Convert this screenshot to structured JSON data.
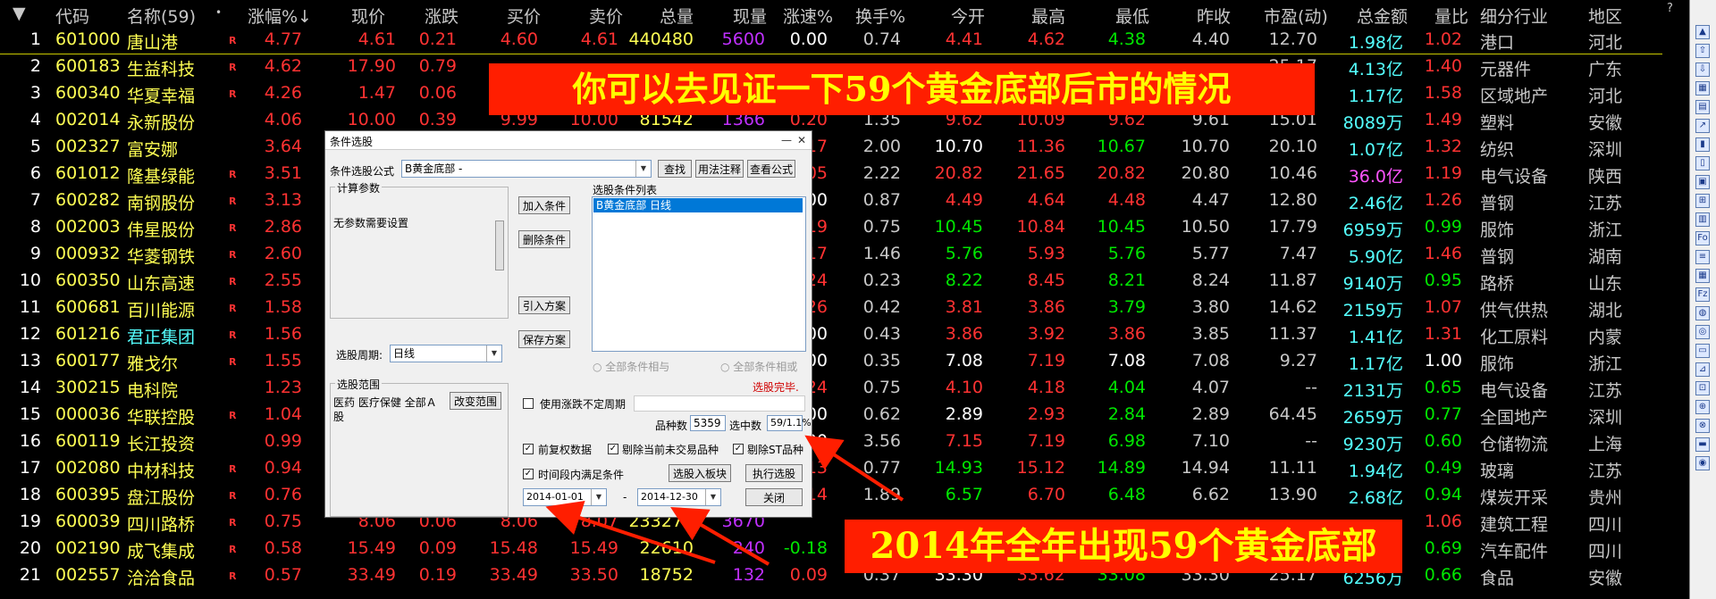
{
  "header": {
    "menu_arrow": "▼",
    "code": "代码",
    "name": "名称(59)",
    "dot": "•",
    "pct": "涨幅%↓",
    "price": "现价",
    "change": "涨跌",
    "bid": "买价",
    "ask": "卖价",
    "volume": "总量",
    "cur_vol": "现量",
    "speed": "涨速%",
    "turnover": "换手%",
    "open": "今开",
    "high": "最高",
    "low": "最低",
    "prev": "昨收",
    "pe": "市盈(动)",
    "amount": "总金额",
    "vol_ratio": "量比",
    "industry": "细分行业",
    "region": "地区",
    "help": "?"
  },
  "rows": [
    {
      "no": "1",
      "code": "601000",
      "name": "唐山港",
      "r": "R",
      "pct": "4.77",
      "price": "4.61",
      "change": "0.21",
      "bid": "4.60",
      "ask": "4.61",
      "volume": "440480",
      "cur_vol": "5600",
      "speed": "0.00",
      "turnover": "0.74",
      "open": "4.41",
      "high": "4.62",
      "low": "4.38",
      "prev": "4.40",
      "pe": "12.70",
      "amount": "1.98亿",
      "vol_ratio": "1.02",
      "industry": "港口",
      "region": "河北"
    },
    {
      "no": "2",
      "code": "600183",
      "name": "生益科技",
      "r": "R",
      "pct": "4.62",
      "price": "17.90",
      "change": "0.79",
      "bid": "",
      "ask": "",
      "volume": "",
      "cur_vol": "",
      "speed": "",
      "turnover": "",
      "open": "",
      "high": "",
      "low": "",
      "prev": "",
      "pe": "25.17",
      "amount": "4.13亿",
      "vol_ratio": "1.40",
      "industry": "元器件",
      "region": "广东"
    },
    {
      "no": "3",
      "code": "600340",
      "name": "华夏幸福",
      "r": "R",
      "pct": "4.26",
      "price": "1.47",
      "change": "0.06",
      "bid": "",
      "ask": "",
      "volume": "",
      "cur_vol": "",
      "speed": "",
      "turnover": "",
      "open": "",
      "high": "",
      "low": "",
      "prev": "",
      "pe": "",
      "amount": "1.17亿",
      "vol_ratio": "1.58",
      "industry": "区域地产",
      "region": "河北"
    },
    {
      "no": "4",
      "code": "002014",
      "name": "永新股份",
      "r": "",
      "pct": "4.06",
      "price": "10.00",
      "change": "0.39",
      "bid": "9.99",
      "ask": "10.00",
      "volume": "81542",
      "cur_vol": "1366",
      "speed": "0.20",
      "turnover": "1.35",
      "open": "9.62",
      "high": "10.09",
      "low": "9.62",
      "prev": "9.61",
      "pe": "15.01",
      "amount": "8089万",
      "vol_ratio": "1.49",
      "industry": "塑料",
      "region": "安徽"
    },
    {
      "no": "5",
      "code": "002327",
      "name": "富安娜",
      "r": "",
      "pct": "3.64",
      "price": "",
      "change": "",
      "bid": "",
      "ask": "",
      "volume": "",
      "cur_vol": "",
      "speed": "17",
      "turnover": "2.00",
      "open": "10.70",
      "high": "11.36",
      "low": "10.67",
      "prev": "10.70",
      "pe": "20.10",
      "amount": "1.07亿",
      "vol_ratio": "1.32",
      "industry": "纺织",
      "region": "深圳"
    },
    {
      "no": "6",
      "code": "601012",
      "name": "隆基绿能",
      "r": "R",
      "pct": "3.51",
      "price": "",
      "change": "",
      "bid": "",
      "ask": "",
      "volume": "",
      "cur_vol": "",
      "speed": "05",
      "turnover": "2.22",
      "open": "20.82",
      "high": "21.65",
      "low": "20.82",
      "prev": "20.80",
      "pe": "10.46",
      "amount": "36.0亿",
      "vol_ratio": "1.19",
      "industry": "电气设备",
      "region": "陕西"
    },
    {
      "no": "7",
      "code": "600282",
      "name": "南钢股份",
      "r": "R",
      "pct": "3.13",
      "price": "",
      "change": "",
      "bid": "",
      "ask": "",
      "volume": "",
      "cur_vol": "",
      "speed": "00",
      "turnover": "0.87",
      "open": "4.49",
      "high": "4.64",
      "low": "4.48",
      "prev": "4.47",
      "pe": "12.80",
      "amount": "2.46亿",
      "vol_ratio": "1.26",
      "industry": "普钢",
      "region": "江苏"
    },
    {
      "no": "8",
      "code": "002003",
      "name": "伟星股份",
      "r": "R",
      "pct": "2.86",
      "price": "",
      "change": "",
      "bid": "",
      "ask": "",
      "volume": "",
      "cur_vol": "",
      "speed": "19",
      "turnover": "0.75",
      "open": "10.45",
      "high": "10.84",
      "low": "10.45",
      "prev": "10.50",
      "pe": "17.79",
      "amount": "6959万",
      "vol_ratio": "0.99",
      "industry": "服饰",
      "region": "浙江"
    },
    {
      "no": "9",
      "code": "000932",
      "name": "华菱钢铁",
      "r": "R",
      "pct": "2.60",
      "price": "",
      "change": "",
      "bid": "",
      "ask": "",
      "volume": "",
      "cur_vol": "",
      "speed": "17",
      "turnover": "1.46",
      "open": "5.76",
      "high": "5.93",
      "low": "5.76",
      "prev": "5.77",
      "pe": "7.47",
      "amount": "5.90亿",
      "vol_ratio": "1.46",
      "industry": "普钢",
      "region": "湖南"
    },
    {
      "no": "10",
      "code": "600350",
      "name": "山东高速",
      "r": "R",
      "pct": "2.55",
      "price": "",
      "change": "",
      "bid": "",
      "ask": "",
      "volume": "",
      "cur_vol": "",
      "speed": "24",
      "turnover": "0.23",
      "open": "8.22",
      "high": "8.45",
      "low": "8.21",
      "prev": "8.24",
      "pe": "11.87",
      "amount": "9140万",
      "vol_ratio": "0.95",
      "industry": "路桥",
      "region": "山东"
    },
    {
      "no": "11",
      "code": "600681",
      "name": "百川能源",
      "r": "R",
      "pct": "1.58",
      "price": "",
      "change": "",
      "bid": "",
      "ask": "",
      "volume": "",
      "cur_vol": "",
      "speed": "26",
      "turnover": "0.42",
      "open": "3.81",
      "high": "3.86",
      "low": "3.79",
      "prev": "3.80",
      "pe": "14.62",
      "amount": "2159万",
      "vol_ratio": "1.07",
      "industry": "供气供热",
      "region": "湖北"
    },
    {
      "no": "12",
      "code": "601216",
      "name": "君正集团",
      "r": "R",
      "pct": "1.56",
      "price": "",
      "change": "",
      "bid": "",
      "ask": "",
      "volume": "",
      "cur_vol": "",
      "speed": "00",
      "turnover": "0.43",
      "open": "3.86",
      "high": "3.92",
      "low": "3.86",
      "prev": "3.85",
      "pe": "11.37",
      "amount": "1.41亿",
      "vol_ratio": "1.31",
      "industry": "化工原料",
      "region": "内蒙"
    },
    {
      "no": "13",
      "code": "600177",
      "name": "雅戈尔",
      "r": "R",
      "pct": "1.55",
      "price": "",
      "change": "",
      "bid": "",
      "ask": "",
      "volume": "",
      "cur_vol": "",
      "speed": "00",
      "turnover": "0.35",
      "open": "7.08",
      "high": "7.19",
      "low": "7.08",
      "prev": "7.08",
      "pe": "9.27",
      "amount": "1.17亿",
      "vol_ratio": "1.00",
      "industry": "服饰",
      "region": "浙江"
    },
    {
      "no": "14",
      "code": "300215",
      "name": "电科院",
      "r": "",
      "pct": "1.23",
      "price": "",
      "change": "",
      "bid": "",
      "ask": "",
      "volume": "",
      "cur_vol": "",
      "speed": "24",
      "turnover": "0.75",
      "open": "4.10",
      "high": "4.18",
      "low": "4.04",
      "prev": "4.07",
      "pe": "--",
      "amount": "2131万",
      "vol_ratio": "0.65",
      "industry": "电气设备",
      "region": "江苏"
    },
    {
      "no": "15",
      "code": "000036",
      "name": "华联控股",
      "r": "R",
      "pct": "1.04",
      "price": "",
      "change": "",
      "bid": "",
      "ask": "",
      "volume": "",
      "cur_vol": "",
      "speed": "00",
      "turnover": "0.62",
      "open": "2.89",
      "high": "2.93",
      "low": "2.84",
      "prev": "2.89",
      "pe": "64.45",
      "amount": "2659万",
      "vol_ratio": "0.77",
      "industry": "全国地产",
      "region": "深圳"
    },
    {
      "no": "16",
      "code": "600119",
      "name": "长江投资",
      "r": "",
      "pct": "0.99",
      "price": "",
      "change": "",
      "bid": "",
      "ask": "",
      "volume": "",
      "cur_vol": "",
      "speed": "00",
      "turnover": "3.56",
      "open": "7.15",
      "high": "7.19",
      "low": "6.98",
      "prev": "7.10",
      "pe": "--",
      "amount": "9230万",
      "vol_ratio": "0.60",
      "industry": "仓储物流",
      "region": "上海"
    },
    {
      "no": "17",
      "code": "002080",
      "name": "中材科技",
      "r": "R",
      "pct": "0.94",
      "price": "",
      "change": "",
      "bid": "",
      "ask": "",
      "volume": "",
      "cur_vol": "",
      "speed": "13",
      "turnover": "0.77",
      "open": "14.93",
      "high": "15.12",
      "low": "14.89",
      "prev": "14.94",
      "pe": "11.11",
      "amount": "1.94亿",
      "vol_ratio": "0.49",
      "industry": "玻璃",
      "region": "江苏"
    },
    {
      "no": "18",
      "code": "600395",
      "name": "盘江股份",
      "r": "R",
      "pct": "0.76",
      "price": "",
      "change": "",
      "bid": "",
      "ask": "",
      "volume": "",
      "cur_vol": "",
      "speed": "14",
      "turnover": "1.89",
      "open": "6.57",
      "high": "6.70",
      "low": "6.48",
      "prev": "6.62",
      "pe": "13.90",
      "amount": "2.68亿",
      "vol_ratio": "0.94",
      "industry": "煤炭开采",
      "region": "贵州"
    },
    {
      "no": "19",
      "code": "600039",
      "name": "四川路桥",
      "r": "R",
      "pct": "0.75",
      "price": "8.06",
      "change": "0.06",
      "bid": "8.06",
      "ask": "8.07",
      "volume": "233273",
      "cur_vol": "3670",
      "speed": "",
      "turnover": "",
      "open": "",
      "high": "",
      "low": "",
      "prev": "",
      "pe": "",
      "amount": "",
      "vol_ratio": "1.06",
      "industry": "建筑工程",
      "region": "四川"
    },
    {
      "no": "20",
      "code": "002190",
      "name": "成飞集成",
      "r": "R",
      "pct": "0.58",
      "price": "15.49",
      "change": "0.09",
      "bid": "15.48",
      "ask": "15.49",
      "volume": "22610",
      "cur_vol": "240",
      "speed": "-0.18",
      "turnover": "",
      "open": "",
      "high": "",
      "low": "",
      "prev": "",
      "pe": "",
      "amount": "",
      "vol_ratio": "0.69",
      "industry": "汽车配件",
      "region": "四川"
    },
    {
      "no": "21",
      "code": "002557",
      "name": "洽洽食品",
      "r": "R",
      "pct": "0.57",
      "price": "33.49",
      "change": "0.19",
      "bid": "33.49",
      "ask": "33.50",
      "volume": "18752",
      "cur_vol": "132",
      "speed": "0.09",
      "turnover": "0.37",
      "open": "33.30",
      "high": "33.62",
      "low": "33.08",
      "prev": "33.30",
      "pe": "25.17",
      "amount": "6256万",
      "vol_ratio": "0.66",
      "industry": "食品",
      "region": "安徽"
    }
  ],
  "dialog": {
    "title": "条件选股",
    "minimize": "—",
    "close": "✕",
    "formula_label": "条件选股公式",
    "formula_value": "B黄金底部  -",
    "find_btn": "查找",
    "usage_btn": "用法注释",
    "view_formula_btn": "查看公式",
    "params_group": "计算参数",
    "params_text": "无参数需要设置",
    "add_btn": "加入条件",
    "delete_btn": "删除条件",
    "import_btn": "引入方案",
    "save_btn": "保存方案",
    "list_group": "选股条件列表",
    "list_item": "B黄金底部  日线",
    "period_label": "选股周期:",
    "period_value": "日线",
    "radio_and": "全部条件相与",
    "radio_or": "全部条件相或",
    "done_text": "选股完毕.",
    "range_group": "选股范围",
    "range_text": "医药 医疗保健 全部Ａ股",
    "change_range_btn": "改变范围",
    "use_change_label": "使用涨跌不定周期",
    "count_label": "品种数",
    "count_value": "5359",
    "selected_label": "选中数",
    "selected_value": "59/1.1%",
    "fq_label": "前复权数据",
    "rm_untraded_label": "剔除当前未交易品种",
    "rm_st_label": "剔除ST品种",
    "time_label": "时间段内满足条件",
    "to_block_btn": "选股入板块",
    "exec_btn": "执行选股",
    "start_date": "2014-01-01",
    "dash": "-",
    "end_date": "2014-12-30",
    "close_btn": "关闭"
  },
  "banners": {
    "top": "你可以去见证一下59个黄金底部后市的情况",
    "bottom": "2014年全年出现59个黄金底部"
  },
  "colors": {
    "up": "#ff3232",
    "down": "#00e600",
    "banner_bg": "#ff1e00",
    "banner_text": "#ffff00"
  }
}
